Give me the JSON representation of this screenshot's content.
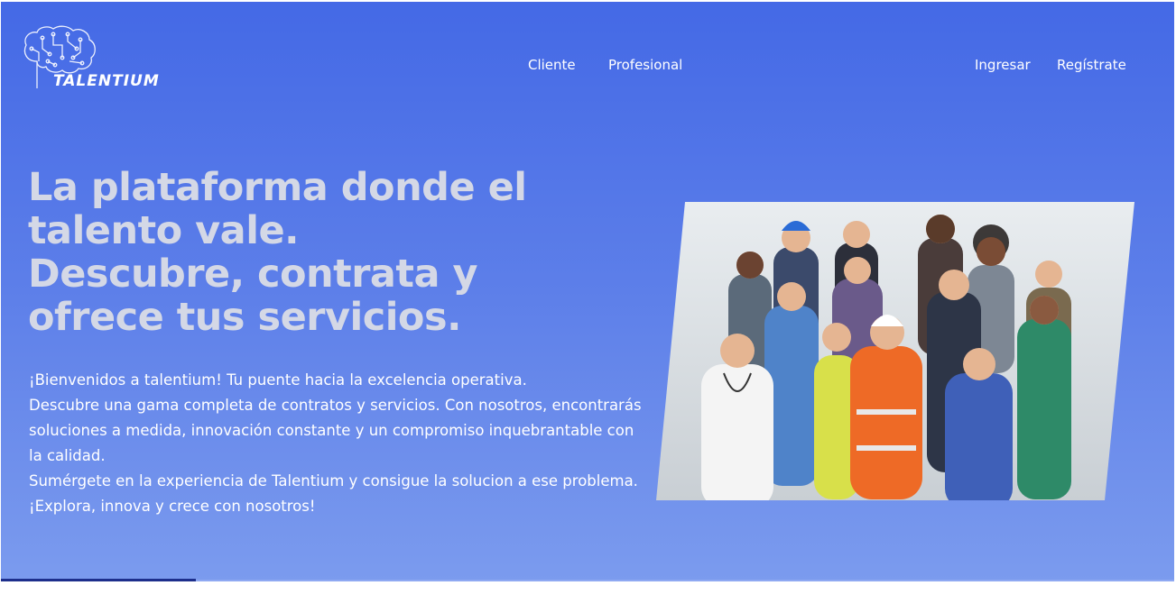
{
  "brand": {
    "name": "TALENTIUM"
  },
  "nav": {
    "cliente": "Cliente",
    "profesional": "Profesional",
    "ingresar": "Ingresar",
    "registrate": "Regístrate"
  },
  "hero": {
    "headline_lines": [
      "La plataforma donde el",
      "talento vale.",
      "Descubre, contrata y",
      "ofrece tus servicios."
    ],
    "intro": [
      "¡Bienvenidos a talentium! Tu puente hacia la excelencia operativa.",
      "Descubre una gama completa de contratos y servicios. Con nosotros, encontrarás soluciones a medida, innovación constante y un compromiso inquebrantable con la calidad.",
      "Sumérgete en la experiencia de Talentium y consigue la solucion a ese problema.",
      "¡Explora, innova y crece con nosotros!"
    ]
  },
  "colors": {
    "hero_top": "#4469e6",
    "hero_bottom": "#7b9bee",
    "headline": "#d4d8e6",
    "text": "#ffffff"
  },
  "icons": {
    "logo": "brain-circuit-icon"
  }
}
